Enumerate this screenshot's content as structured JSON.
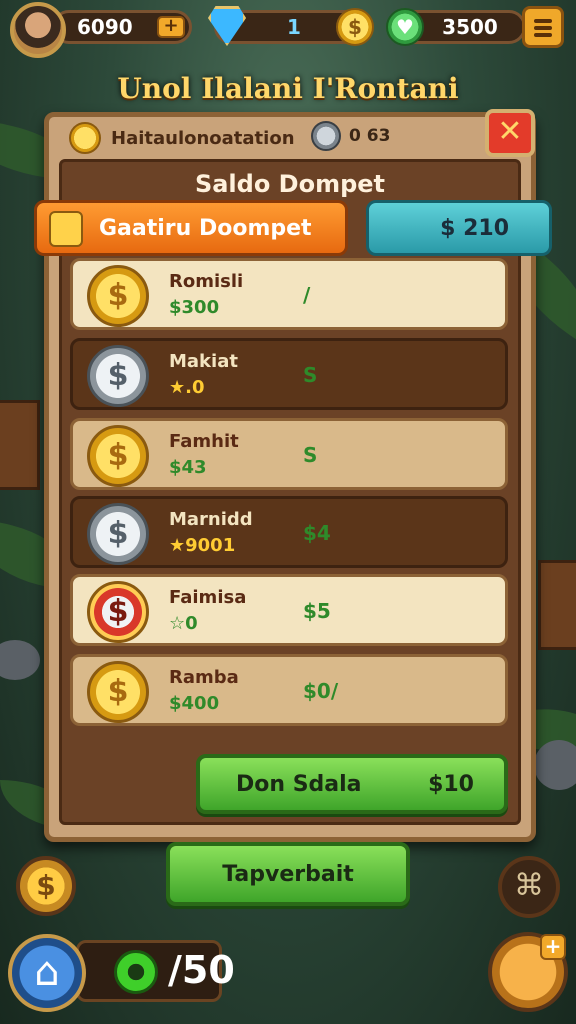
{
  "top_bar": {
    "coins": "6090",
    "gems": "1",
    "cash": "3500",
    "coins_plus": "+",
    "coin_symbol": "$",
    "green_symbol": "♥"
  },
  "game_title": "Unol Ilalani I'Rontani",
  "panel": {
    "header_text": "Haitaulonoatation",
    "header_count": "0 63",
    "close_label": "✕",
    "section_title": "Saldo Dompet"
  },
  "tabs": {
    "left_label": "Gaatiru Doompet",
    "right_label": "$ 210"
  },
  "rows": [
    {
      "name": "Romisli",
      "amount": "$300",
      "value": "/",
      "style": "light",
      "coin": "gold"
    },
    {
      "name": "Makiat",
      "amount": "★.0",
      "value": "S",
      "style": "dark",
      "coin": "silver"
    },
    {
      "name": "Famhit",
      "amount": "$43",
      "value": "S",
      "style": "mid",
      "coin": "gold"
    },
    {
      "name": "Marnidd",
      "amount": "★9001",
      "value": "$4",
      "style": "dark",
      "coin": "silver"
    },
    {
      "name": "Faimisa",
      "amount": "☆0",
      "value": "$5",
      "style": "light",
      "coin": "red"
    },
    {
      "name": "Ramba",
      "amount": "$400",
      "value": "$0/",
      "style": "mid",
      "coin": "gold"
    }
  ],
  "buttons": {
    "send_label": "Don Sdala",
    "send_value": "$10",
    "transfer_label": "Tapverbait"
  },
  "bottom": {
    "coin_symbol": "$",
    "settings_symbol": "⌘",
    "home_symbol": "⌂",
    "counter": "/50",
    "chest_plus": "+"
  },
  "colors": {
    "panel": "#c9a37a",
    "orange_tab": "#e76a10",
    "teal_tab": "#2a9aa8",
    "green_button": "#3fa52a",
    "close_button": "#e33b2a"
  }
}
